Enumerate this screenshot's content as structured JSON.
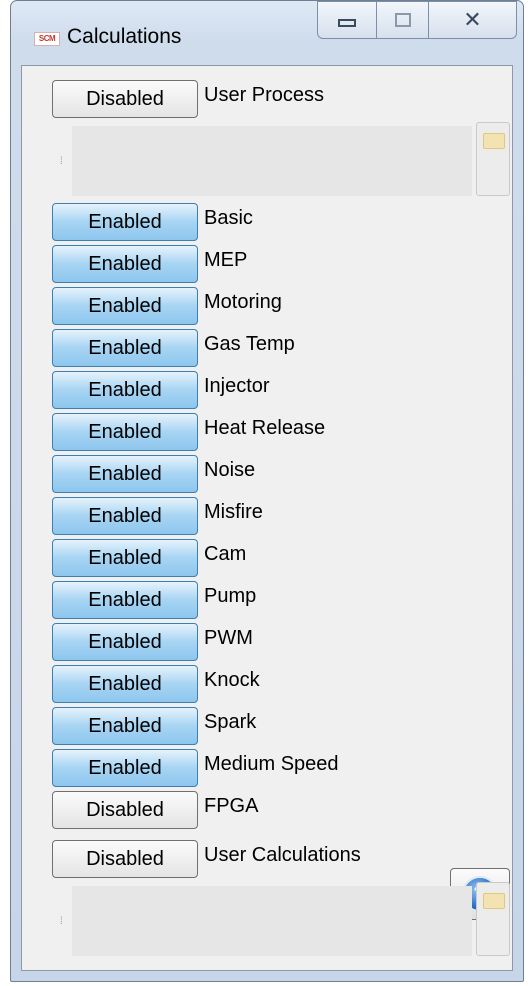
{
  "window": {
    "title": "Calculations",
    "app_icon_text": "SCM"
  },
  "user_process": {
    "state": "Disabled",
    "label": "User Process"
  },
  "calculations": [
    {
      "state": "Enabled",
      "label": "Basic"
    },
    {
      "state": "Enabled",
      "label": "MEP"
    },
    {
      "state": "Enabled",
      "label": "Motoring"
    },
    {
      "state": "Enabled",
      "label": "Gas Temp"
    },
    {
      "state": "Enabled",
      "label": "Injector"
    },
    {
      "state": "Enabled",
      "label": "Heat Release"
    },
    {
      "state": "Enabled",
      "label": "Noise"
    },
    {
      "state": "Enabled",
      "label": "Misfire"
    },
    {
      "state": "Enabled",
      "label": "Cam"
    },
    {
      "state": "Enabled",
      "label": "Pump"
    },
    {
      "state": "Enabled",
      "label": "PWM"
    },
    {
      "state": "Enabled",
      "label": "Knock"
    },
    {
      "state": "Enabled",
      "label": "Spark"
    },
    {
      "state": "Enabled",
      "label": "Medium Speed"
    },
    {
      "state": "Disabled",
      "label": "FPGA"
    }
  ],
  "user_calculations": {
    "state": "Disabled",
    "label": "User Calculations"
  },
  "help": {
    "glyph": "?"
  },
  "colors": {
    "enabled": "#a7d4f3",
    "disabled": "#e4e4e4",
    "help_icon": "#2f6fc4"
  },
  "icons": [
    "app-logo-icon",
    "minimize-icon",
    "maximize-icon",
    "close-icon",
    "folder-icon",
    "grip-icon",
    "help-icon"
  ]
}
